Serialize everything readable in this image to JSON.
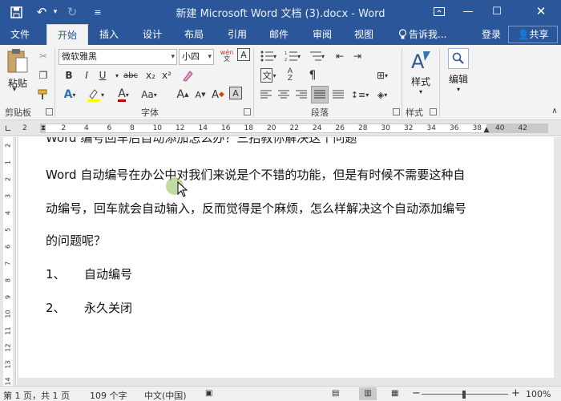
{
  "window": {
    "title": "新建 Microsoft Word 文档 (3).docx - Word",
    "undo_icon": "undo-icon",
    "redo_icon": "redo-icon",
    "save_icon": "save-icon"
  },
  "tabs": [
    "文件",
    "开始",
    "插入",
    "设计",
    "布局",
    "引用",
    "邮件",
    "审阅",
    "视图"
  ],
  "active_tab": "开始",
  "tell_me": "告诉我...",
  "login": "登录",
  "share": "共享",
  "ribbon": {
    "clipboard": {
      "paste_label": "粘贴",
      "group_label": "剪贴板"
    },
    "font": {
      "font_name": "微软雅黑",
      "font_size": "小四",
      "wen_label": "wén\n文",
      "group_label": "字体",
      "bold": "B",
      "italic": "I",
      "underline": "U",
      "strike": "abc",
      "subscript": "x₂",
      "superscript": "x²",
      "grow": "A",
      "shrink": "A",
      "case": "Aa",
      "clear": "A"
    },
    "paragraph": {
      "group_label": "段落"
    },
    "styles": {
      "label": "样式",
      "group_label": "样式"
    },
    "editing": {
      "label": "编辑"
    }
  },
  "ruler": {
    "h_numbers": [
      "2",
      "2",
      "4",
      "6",
      "8",
      "10",
      "12",
      "14",
      "16",
      "18",
      "20",
      "22",
      "24",
      "26",
      "28",
      "30",
      "32",
      "34",
      "36",
      "38",
      "40",
      "42"
    ],
    "v_numbers": [
      "2",
      "1",
      "2",
      "3",
      "4",
      "5",
      "6",
      "7",
      "8",
      "9",
      "10",
      "11",
      "12",
      "13",
      "14"
    ]
  },
  "document": {
    "heading_cut": "Word 编号回车后自动添加怎么办？三招教你解决这个问题",
    "para1_line1": "Word 自动编号在办公中对我们来说是个不错的功能，但是有时候不需要这种自",
    "para1_line2": "动编号，回车就会自动输入，反而觉得是个麻烦，怎么样解决这个自动添加编号",
    "para1_line3": "的问题呢？",
    "list": [
      {
        "num": "1、",
        "text": "自动编号"
      },
      {
        "num": "2、",
        "text": "永久关闭"
      }
    ]
  },
  "status": {
    "page": "第 1 页，共 1 页",
    "words": "109 个字",
    "lang": "中文(中国)",
    "zoom": "100%",
    "zoom_minus": "−",
    "zoom_plus": "+"
  }
}
